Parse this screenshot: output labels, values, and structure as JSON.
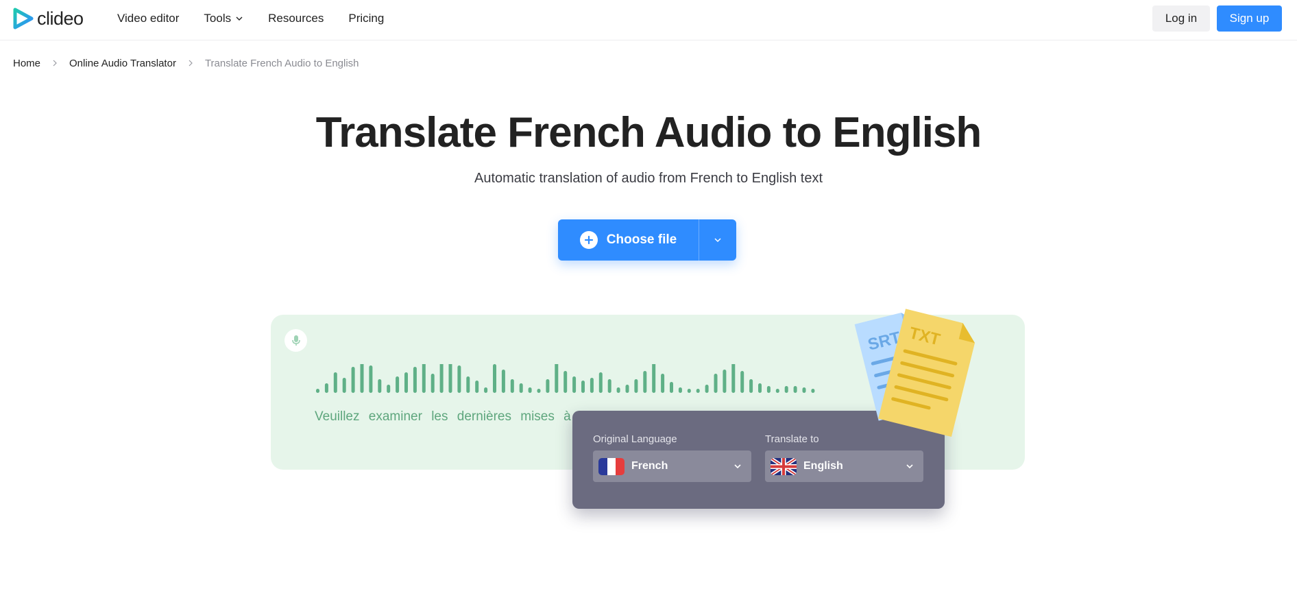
{
  "header": {
    "logo_text": "clideo",
    "nav": [
      {
        "label": "Video editor",
        "has_dropdown": false
      },
      {
        "label": "Tools",
        "has_dropdown": true
      },
      {
        "label": "Resources",
        "has_dropdown": false
      },
      {
        "label": "Pricing",
        "has_dropdown": false
      }
    ],
    "login_label": "Log in",
    "signup_label": "Sign up"
  },
  "breadcrumb": [
    {
      "label": "Home"
    },
    {
      "label": "Online Audio Translator"
    },
    {
      "label": "Translate French Audio to English"
    }
  ],
  "hero": {
    "title": "Translate French Audio to English",
    "subtitle": "Automatic translation of audio from French to English text",
    "choose_file_label": "Choose file"
  },
  "illustration": {
    "transcript": "Veuillez examiner les dernières mises à",
    "original_language_label": "Original Language",
    "original_language": "French",
    "translate_to_label": "Translate to",
    "target_language": "English",
    "doc_back_label": "SRT",
    "doc_front_label": "TXT"
  },
  "colors": {
    "accent": "#2f8cff",
    "panel_bg": "#e6f5ea",
    "wave": "#5fb087",
    "lang_card": "#6b6b80",
    "doc_yellow": "#f5d66a",
    "doc_blue": "#b9dcff"
  }
}
